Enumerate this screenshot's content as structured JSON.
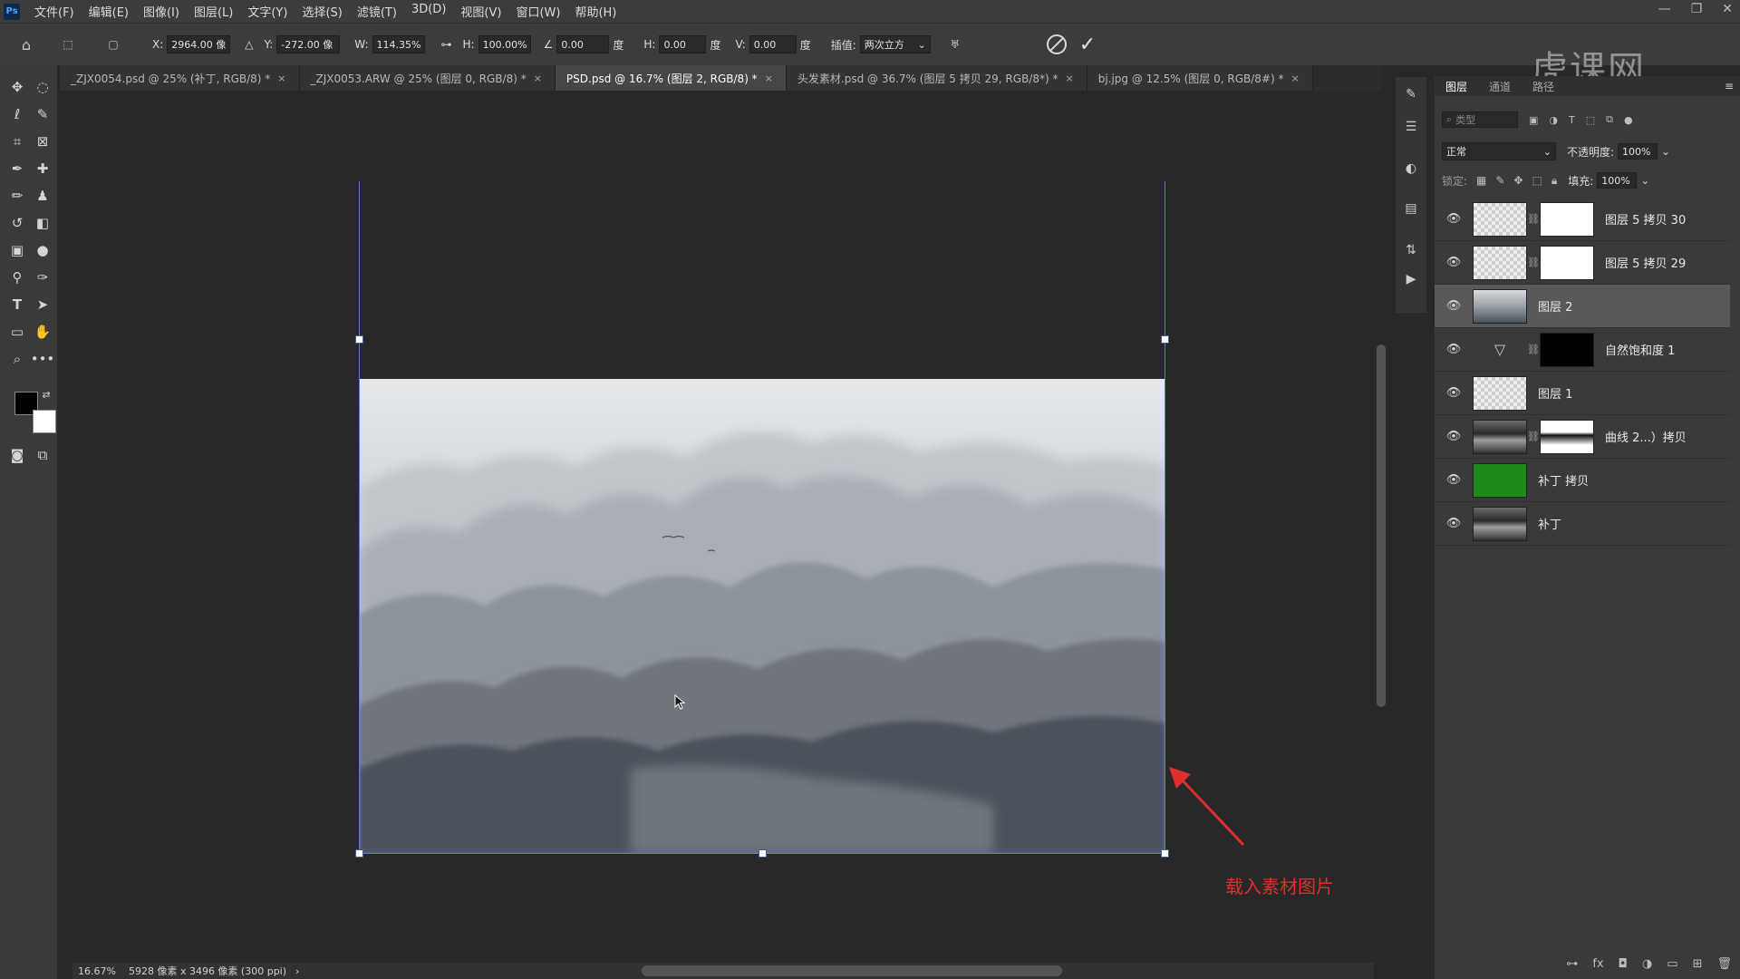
{
  "app": {
    "logo": "Ps"
  },
  "menu": [
    "文件(F)",
    "编辑(E)",
    "图像(I)",
    "图层(L)",
    "文字(Y)",
    "选择(S)",
    "滤镜(T)",
    "3D(D)",
    "视图(V)",
    "窗口(W)",
    "帮助(H)"
  ],
  "options": {
    "x_label": "X:",
    "x_value": "2964.00 像",
    "y_label": "Y:",
    "y_value": "-272.00 像",
    "w_label": "W:",
    "w_value": "114.35%",
    "h_label": "H:",
    "h_value": "100.00%",
    "angle_value": "0.00",
    "angle_unit": "度",
    "hskew_label": "H:",
    "hskew_value": "0.00",
    "hskew_unit": "度",
    "vskew_label": "V:",
    "vskew_value": "0.00",
    "vskew_unit": "度",
    "interp_label": "插值:",
    "interp_value": "两次立方",
    "watermark": "虎课网"
  },
  "tabs": [
    {
      "label": "_ZJX0054.psd @ 25% (补丁, RGB/8) *",
      "active": false
    },
    {
      "label": "_ZJX0053.ARW @ 25% (图层 0, RGB/8) *",
      "active": false
    },
    {
      "label": "PSD.psd @ 16.7% (图层 2, RGB/8) *",
      "active": true
    },
    {
      "label": "头发素材.psd @ 36.7% (图层 5 拷贝 29, RGB/8*) *",
      "active": false
    },
    {
      "label": "bj.jpg @ 12.5% (图层 0, RGB/8#) *",
      "active": false
    }
  ],
  "canvas": {
    "annotation": "载入素材图片",
    "arrow_color": "#e22d2d"
  },
  "status": {
    "zoom": "16.67%",
    "doc_info": "5928 像素 x 3496 像素 (300 ppi)"
  },
  "panel": {
    "tabs": [
      "图层",
      "通道",
      "路径"
    ],
    "filter_placeholder": "类型",
    "blend_mode": "正常",
    "opacity_label": "不透明度:",
    "opacity_value": "100%",
    "lock_label": "锁定:",
    "fill_label": "填充:",
    "fill_value": "100%"
  },
  "layers": [
    {
      "name": "图层 5 拷贝 30",
      "thumb": "checker",
      "mask": "white",
      "selected": false
    },
    {
      "name": "图层 5 拷贝 29",
      "thumb": "checker",
      "mask": "white",
      "selected": false
    },
    {
      "name": "图层 2",
      "thumb": "mist",
      "mask": null,
      "selected": true
    },
    {
      "name": "自然饱和度 1",
      "thumb": "adjust",
      "mask": "black",
      "selected": false
    },
    {
      "name": "图层 1",
      "thumb": "checker",
      "mask": null,
      "selected": false
    },
    {
      "name": "曲线 2...）拷贝",
      "thumb": "photo",
      "mask": "photomask",
      "selected": false
    },
    {
      "name": "补丁 拷贝",
      "thumb": "green",
      "mask": null,
      "selected": false
    },
    {
      "name": "补丁",
      "thumb": "photo",
      "mask": null,
      "selected": false
    }
  ]
}
